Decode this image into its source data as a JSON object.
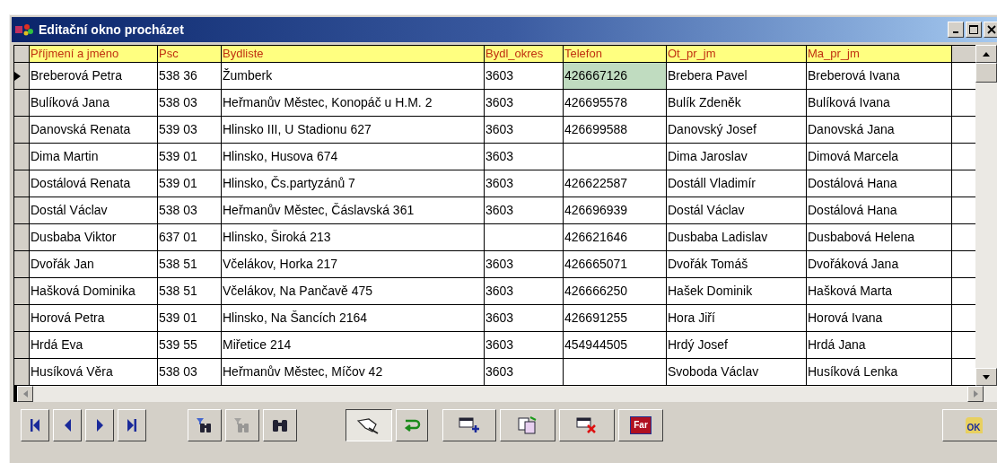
{
  "window": {
    "title": "Editační okno procházet"
  },
  "table": {
    "columns": [
      "Příjmení a jméno",
      "Psc",
      "Bydliste",
      "Bydl_okres",
      "Telefon",
      "Ot_pr_jm",
      "Ma_pr_jm"
    ],
    "rows": [
      {
        "current": true,
        "cells": [
          {
            "text": "Breberová Petra",
            "selected": false
          },
          {
            "text": "538 36",
            "selected": false
          },
          {
            "text": "Žumberk",
            "selected": false
          },
          {
            "text": "3603",
            "selected": false
          },
          {
            "text": "426667126",
            "selected": true
          },
          {
            "text": "Brebera Pavel",
            "selected": false
          },
          {
            "text": "Breberová Ivana",
            "selected": false
          }
        ]
      },
      {
        "current": false,
        "cells": [
          {
            "text": "Bulíková Jana",
            "selected": false
          },
          {
            "text": "538 03",
            "selected": false
          },
          {
            "text": "Heřmanův Městec, Konopáč u H.M. 2",
            "selected": false
          },
          {
            "text": "3603",
            "selected": false
          },
          {
            "text": "426695578",
            "selected": false
          },
          {
            "text": "Bulík Zdeněk",
            "selected": false
          },
          {
            "text": "Bulíková Ivana",
            "selected": false
          }
        ]
      },
      {
        "current": false,
        "cells": [
          {
            "text": "Danovská Renata",
            "selected": false
          },
          {
            "text": "539 03",
            "selected": false
          },
          {
            "text": "Hlinsko III, U Stadionu 627",
            "selected": false
          },
          {
            "text": "3603",
            "selected": false
          },
          {
            "text": "426699588",
            "selected": false
          },
          {
            "text": "Danovský Josef",
            "selected": false
          },
          {
            "text": "Danovská Jana",
            "selected": false
          }
        ]
      },
      {
        "current": false,
        "cells": [
          {
            "text": "Dima Martin",
            "selected": false
          },
          {
            "text": "539 01",
            "selected": false
          },
          {
            "text": "Hlinsko, Husova 674",
            "selected": false
          },
          {
            "text": "3603",
            "selected": false
          },
          {
            "selected": false
          },
          {
            "text": "Dima Jaroslav",
            "selected": false
          },
          {
            "text": "Dimová Marcela",
            "selected": false
          }
        ]
      },
      {
        "current": false,
        "cells": [
          {
            "text": "Dostálová Renata",
            "selected": false
          },
          {
            "text": "539 01",
            "selected": false
          },
          {
            "text": "Hlinsko, Čs.partyzánů 7",
            "selected": false
          },
          {
            "text": "3603",
            "selected": false
          },
          {
            "text": "426622587",
            "selected": false
          },
          {
            "text": "Dostáll Vladimír",
            "selected": false
          },
          {
            "text": "Dostálová Hana",
            "selected": false
          }
        ]
      },
      {
        "current": false,
        "cells": [
          {
            "text": "Dostál Václav",
            "selected": false
          },
          {
            "text": "538 03",
            "selected": false
          },
          {
            "text": "Heřmanův Městec, Čáslavská 361",
            "selected": false
          },
          {
            "text": "3603",
            "selected": false
          },
          {
            "text": "426696939",
            "selected": false
          },
          {
            "text": "Dostál  Václav",
            "selected": false
          },
          {
            "text": "Dostálová Hana",
            "selected": false
          }
        ]
      },
      {
        "current": false,
        "cells": [
          {
            "text": "Dusbaba Viktor",
            "selected": false
          },
          {
            "text": "637 01",
            "selected": false
          },
          {
            "text": "Hlinsko, Široká 213",
            "selected": false
          },
          {
            "selected": false
          },
          {
            "text": "426621646",
            "selected": false
          },
          {
            "text": "Dusbaba Ladislav",
            "selected": false
          },
          {
            "text": "Dusbabová Helena",
            "selected": false
          }
        ]
      },
      {
        "current": false,
        "cells": [
          {
            "text": "Dvořák Jan",
            "selected": false
          },
          {
            "text": "538 51",
            "selected": false
          },
          {
            "text": "Včelákov, Horka 217",
            "selected": false
          },
          {
            "text": "3603",
            "selected": false
          },
          {
            "text": "426665071",
            "selected": false
          },
          {
            "text": "Dvořák Tomáš",
            "selected": false
          },
          {
            "text": "Dvořáková Jana",
            "selected": false
          }
        ]
      },
      {
        "current": false,
        "cells": [
          {
            "text": "Hašková Dominika",
            "selected": false
          },
          {
            "text": "538 51",
            "selected": false
          },
          {
            "text": "Včelákov, Na Pančavě 475",
            "selected": false
          },
          {
            "text": "3603",
            "selected": false
          },
          {
            "text": "426666250",
            "selected": false
          },
          {
            "text": "Hašek Dominik",
            "selected": false
          },
          {
            "text": "Hašková Marta",
            "selected": false
          }
        ]
      },
      {
        "current": false,
        "cells": [
          {
            "text": "Horová Petra",
            "selected": false
          },
          {
            "text": "539 01",
            "selected": false
          },
          {
            "text": "Hlinsko, Na Šancích 2164",
            "selected": false
          },
          {
            "text": "3603",
            "selected": false
          },
          {
            "text": "426691255",
            "selected": false
          },
          {
            "text": "Hora Jiří",
            "selected": false
          },
          {
            "text": "Horová Ivana",
            "selected": false
          }
        ]
      },
      {
        "current": false,
        "cells": [
          {
            "text": "Hrdá Eva",
            "selected": false
          },
          {
            "text": "539 55",
            "selected": false
          },
          {
            "text": "Miřetice 214",
            "selected": false
          },
          {
            "text": "3603",
            "selected": false
          },
          {
            "text": "454944505",
            "selected": false
          },
          {
            "text": "Hrdý Josef",
            "selected": false
          },
          {
            "text": "Hrdá Jana",
            "selected": false
          }
        ]
      },
      {
        "current": false,
        "cells": [
          {
            "text": "Husíková Věra",
            "selected": false
          },
          {
            "text": "538 03",
            "selected": false
          },
          {
            "text": "Heřmanův Městec, Míčov 42",
            "selected": false
          },
          {
            "text": "3603",
            "selected": false
          },
          {
            "selected": false
          },
          {
            "text": "Svoboda Václav",
            "selected": false
          },
          {
            "text": "Husíková Lenka",
            "selected": false
          }
        ]
      }
    ]
  },
  "toolbar": [
    {
      "kind": "first",
      "pressed": false,
      "disabled": false
    },
    {
      "kind": "prev",
      "pressed": false,
      "disabled": false
    },
    {
      "kind": "next",
      "pressed": false,
      "disabled": false
    },
    {
      "kind": "last",
      "pressed": false,
      "disabled": false
    },
    {
      "kind": "filter",
      "pressed": false,
      "disabled": false
    },
    {
      "kind": "filter",
      "pressed": false,
      "disabled": true
    },
    {
      "kind": "find",
      "pressed": false,
      "disabled": false
    },
    {
      "kind": "edit",
      "pressed": true,
      "disabled": false
    },
    {
      "kind": "undo",
      "pressed": false,
      "disabled": false
    },
    {
      "kind": "add",
      "pressed": false,
      "disabled": false
    },
    {
      "kind": "copy",
      "pressed": false,
      "disabled": false
    },
    {
      "kind": "delete",
      "pressed": false,
      "disabled": false
    },
    {
      "kind": "label",
      "label": "Far",
      "pressed": false,
      "disabled": false
    },
    {
      "kind": "ok",
      "label": "OK",
      "pressed": false,
      "disabled": false
    }
  ]
}
